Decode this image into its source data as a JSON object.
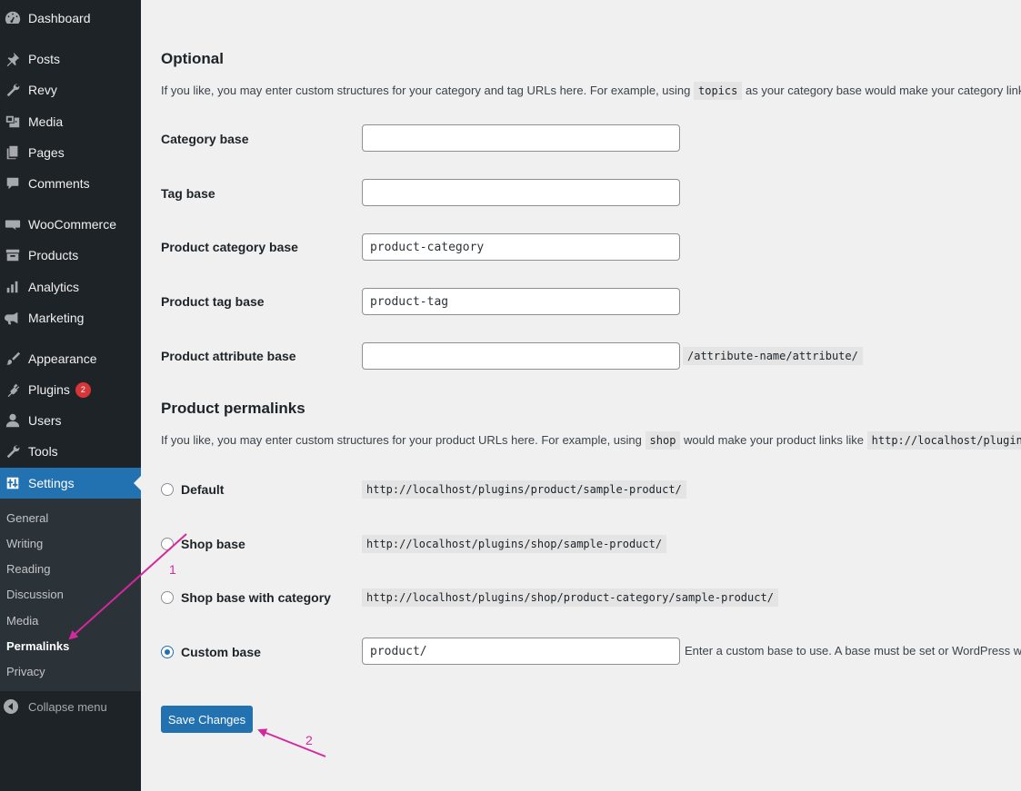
{
  "sidebar": {
    "items": [
      {
        "label": "Dashboard",
        "icon": "dashboard-icon"
      },
      {
        "label": "Posts",
        "icon": "pin-icon"
      },
      {
        "label": "Revy",
        "icon": "wrench-icon"
      },
      {
        "label": "Media",
        "icon": "media-icon"
      },
      {
        "label": "Pages",
        "icon": "pages-icon"
      },
      {
        "label": "Comments",
        "icon": "comment-icon"
      },
      {
        "label": "WooCommerce",
        "icon": "woo-icon"
      },
      {
        "label": "Products",
        "icon": "archive-icon"
      },
      {
        "label": "Analytics",
        "icon": "chart-bar-icon"
      },
      {
        "label": "Marketing",
        "icon": "megaphone-icon"
      },
      {
        "label": "Appearance",
        "icon": "brush-icon"
      },
      {
        "label": "Plugins",
        "icon": "plugin-icon",
        "badge": "2"
      },
      {
        "label": "Users",
        "icon": "user-icon"
      },
      {
        "label": "Tools",
        "icon": "wrench-icon"
      },
      {
        "label": "Settings",
        "icon": "settings-icon",
        "active": true
      }
    ],
    "submenu": [
      "General",
      "Writing",
      "Reading",
      "Discussion",
      "Media",
      "Permalinks",
      "Privacy"
    ],
    "submenu_current": "Permalinks",
    "collapse_label": "Collapse menu"
  },
  "optional": {
    "heading": "Optional",
    "desc_before": "If you like, you may enter custom structures for your category and tag URLs here. For example, using",
    "desc_code": "topics",
    "desc_after": "as your category base would make your category links"
  },
  "fields": [
    {
      "label": "Category base",
      "value": ""
    },
    {
      "label": "Tag base",
      "value": ""
    },
    {
      "label": "Product category base",
      "value": "product-category"
    },
    {
      "label": "Product tag base",
      "value": "product-tag"
    },
    {
      "label": "Product attribute base",
      "value": "",
      "suffix": "/attribute-name/attribute/"
    }
  ],
  "product_permalinks": {
    "heading": "Product permalinks",
    "desc_before": "If you like, you may enter custom structures for your product URLs here. For example, using",
    "desc_code": "shop",
    "desc_middle": "would make your product links like",
    "desc_code2": "http://localhost/plugins",
    "options": [
      {
        "label": "Default",
        "code": "http://localhost/plugins/product/sample-product/",
        "checked": false
      },
      {
        "label": "Shop base",
        "code": "http://localhost/plugins/shop/sample-product/",
        "checked": false
      },
      {
        "label": "Shop base with category",
        "code": "http://localhost/plugins/shop/product-category/sample-product/",
        "checked": false
      },
      {
        "label": "Custom base",
        "input_value": "product/",
        "note": "Enter a custom base to use. A base must be set or WordPress wil",
        "checked": true
      }
    ]
  },
  "save_label": "Save Changes",
  "annotations": [
    "1",
    "2"
  ],
  "colors": {
    "sidebar_bg": "#1d2327",
    "active": "#2271b1",
    "annotation": "#d6289e"
  }
}
